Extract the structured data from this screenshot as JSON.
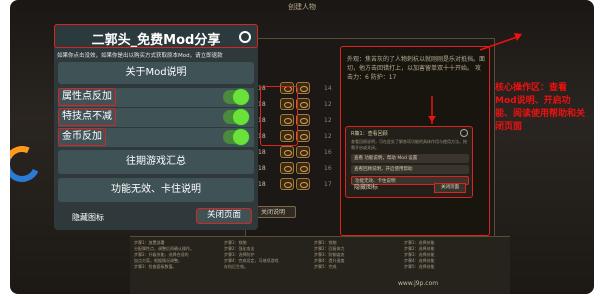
{
  "game": {
    "top_title": "创建人物",
    "description_text": "外观：焦苦灰的了人物刺杭以就刚刚是乐对抵挡。面切，他方击回错打上，以加害留单双十十开始。 攻击力：6 防护：17",
    "stats": [
      {
        "num": "18",
        "val": "14"
      },
      {
        "num": "18",
        "val": "12"
      },
      {
        "num": "18",
        "val": "12"
      },
      {
        "num": "18",
        "val": "12"
      },
      {
        "num": "18",
        "val": "16"
      },
      {
        "num": "18",
        "val": "16"
      },
      {
        "num": "18",
        "val": "17"
      }
    ],
    "bottom_button": "关闭说明",
    "skill_columns": [
      "步骤1：放置部署\n分配属性点，调整后再确认操作。\n步骤2：升级技能，选择合适的\n加点方案，根据情况调整。\n步骤3：检查面板数值。",
      "步骤1：铁腕\n步骤2：强化攻击\n步骤3：选择防护\n步骤4：完成设定，可继续游戏\n存档后生效。",
      "步骤1：铁腕\n步骤2：回复体力\n步骤3：防御姿态\n步骤4：提升速度\n步骤5：完成",
      "步骤1：选择技能\n步骤2：选择技能\n步骤3：选择技能\n步骤4：选择技能\n步骤5：选择技能"
    ],
    "watermark": "www.j9p.com"
  },
  "help_dialog": {
    "title": "R策1：查看回顾",
    "body": "查看回顾说明，可在此处了解各项功能的具体作用与使用方法，按需开启或关闭。",
    "bar1": "查看 功能说明，帮助 Mod 设置",
    "bar2": "查看回顾说明，开启使用帮助",
    "bar3": "功能无效、卡住说明",
    "hide_label": "隐藏图标",
    "close_label": "关闭页面"
  },
  "mod_menu": {
    "title": "二郭头_免费Mod分享",
    "note": "如果你点击没效，如果你是出以购买方式获取原本Mod，请立即退款",
    "about_label": "关于Mod说明",
    "toggles": [
      {
        "label": "属性点反加",
        "on": true
      },
      {
        "label": "特技点不减",
        "on": true
      },
      {
        "label": "金币反加",
        "on": true
      }
    ],
    "history_label": "往期游戏汇总",
    "invalid_label": "功能无效、卡住说明",
    "hide_label": "隐藏图标",
    "close_label": "关闭页面"
  },
  "annotation": {
    "text": "核心操作区：查看Mod说明、开启功能、阅读使用帮助和关闭页面"
  },
  "colors": {
    "accent_red": "#dd2222",
    "toggle_green": "#6be23a",
    "menu_bg": "#3f5256"
  }
}
